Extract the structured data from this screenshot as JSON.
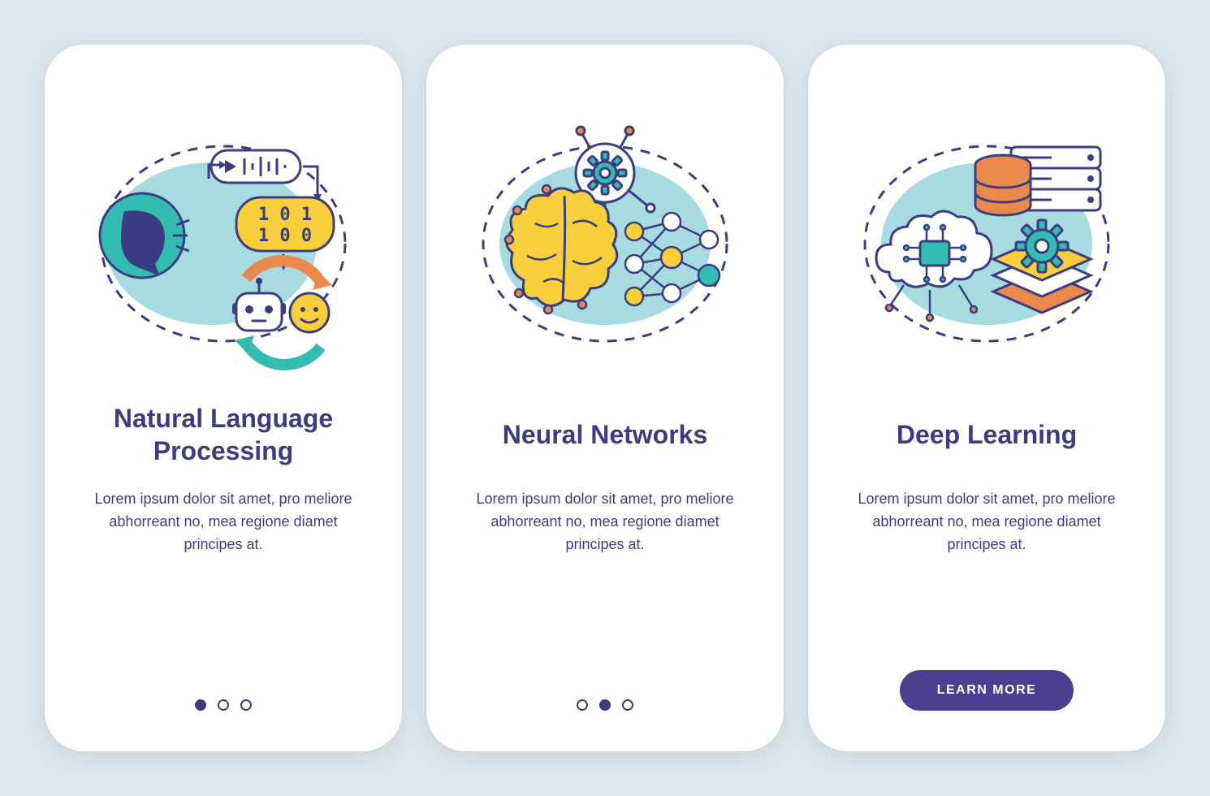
{
  "colors": {
    "stroke": "#3c3c82",
    "teal": "#33bdb0",
    "yellow": "#f7cf3a",
    "orange": "#e98a4c",
    "lightTeal": "#a6dbe0",
    "purple": "#4b3f8f",
    "white": "#ffffff"
  },
  "screens": [
    {
      "title": "Natural Language Processing",
      "desc": "Lorem ipsum dolor sit amet, pro meliore abhorreant no, mea regione diamet principes at.",
      "activeDot": 0,
      "hasButton": false
    },
    {
      "title": "Neural Networks",
      "desc": "Lorem ipsum dolor sit amet, pro meliore abhorreant no, mea regione diamet principes at.",
      "activeDot": 1,
      "hasButton": false
    },
    {
      "title": "Deep Learning",
      "desc": "Lorem ipsum dolor sit amet, pro meliore abhorreant no, mea regione diamet principes at.",
      "activeDot": 2,
      "hasButton": true
    }
  ],
  "buttonLabel": "LEARN MORE",
  "totalDots": 3,
  "illustrations": {
    "nlp": {
      "binaryLine1": "1 0 1",
      "binaryLine2": "1 0 0"
    }
  }
}
